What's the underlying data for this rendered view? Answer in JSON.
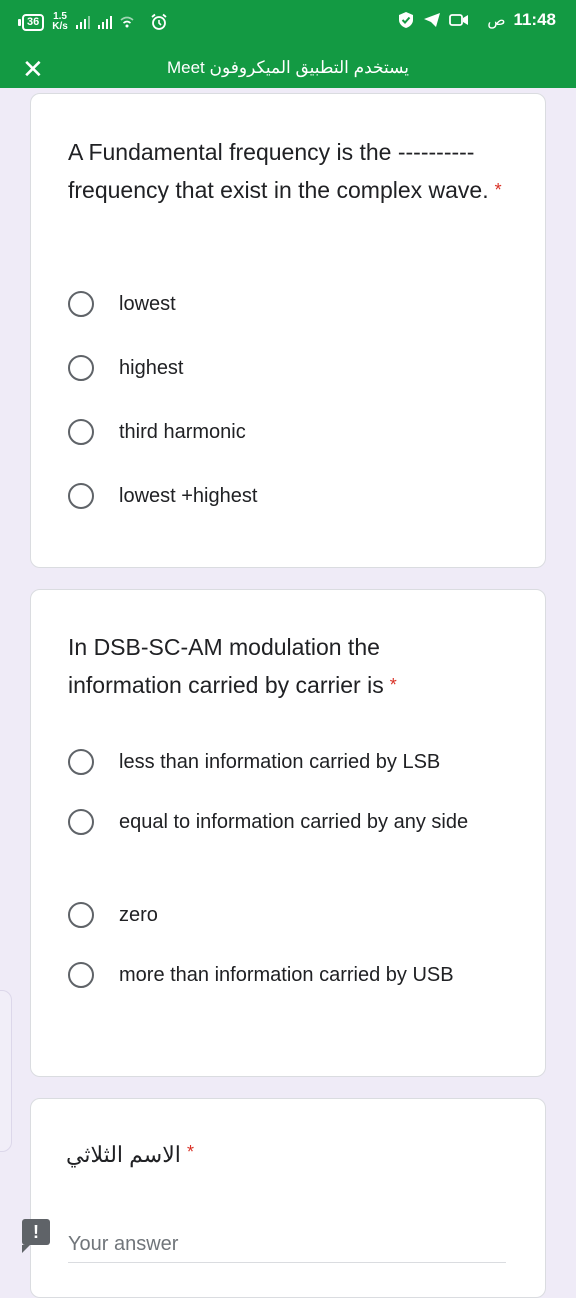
{
  "status_bar": {
    "battery": "36",
    "net_speed_value": "1.5",
    "net_speed_unit": "K/s",
    "time": "11:48",
    "ampm": "ص"
  },
  "title_bar": {
    "title": "يستخدم التطبيق الميكروفون Meet"
  },
  "colors": {
    "header": "#139a43",
    "background": "#efebf7",
    "required": "#d93025"
  },
  "questions": [
    {
      "text": "A Fundamental frequency is the ----------frequency that exist in the complex wave.",
      "required_mark": "*",
      "options": [
        "lowest",
        "highest",
        "third harmonic",
        "lowest +highest"
      ]
    },
    {
      "text": "In DSB-SC-AM modulation the information carried by carrier is",
      "required_mark": "*",
      "options": [
        "less than information carried by LSB",
        "equal to information carried by any side",
        "zero",
        "more than information carried by USB"
      ]
    },
    {
      "text": "الاسم الثلاثي",
      "required_mark": "*",
      "answer_placeholder": "Your answer"
    }
  ],
  "warning_icon_glyph": "!"
}
